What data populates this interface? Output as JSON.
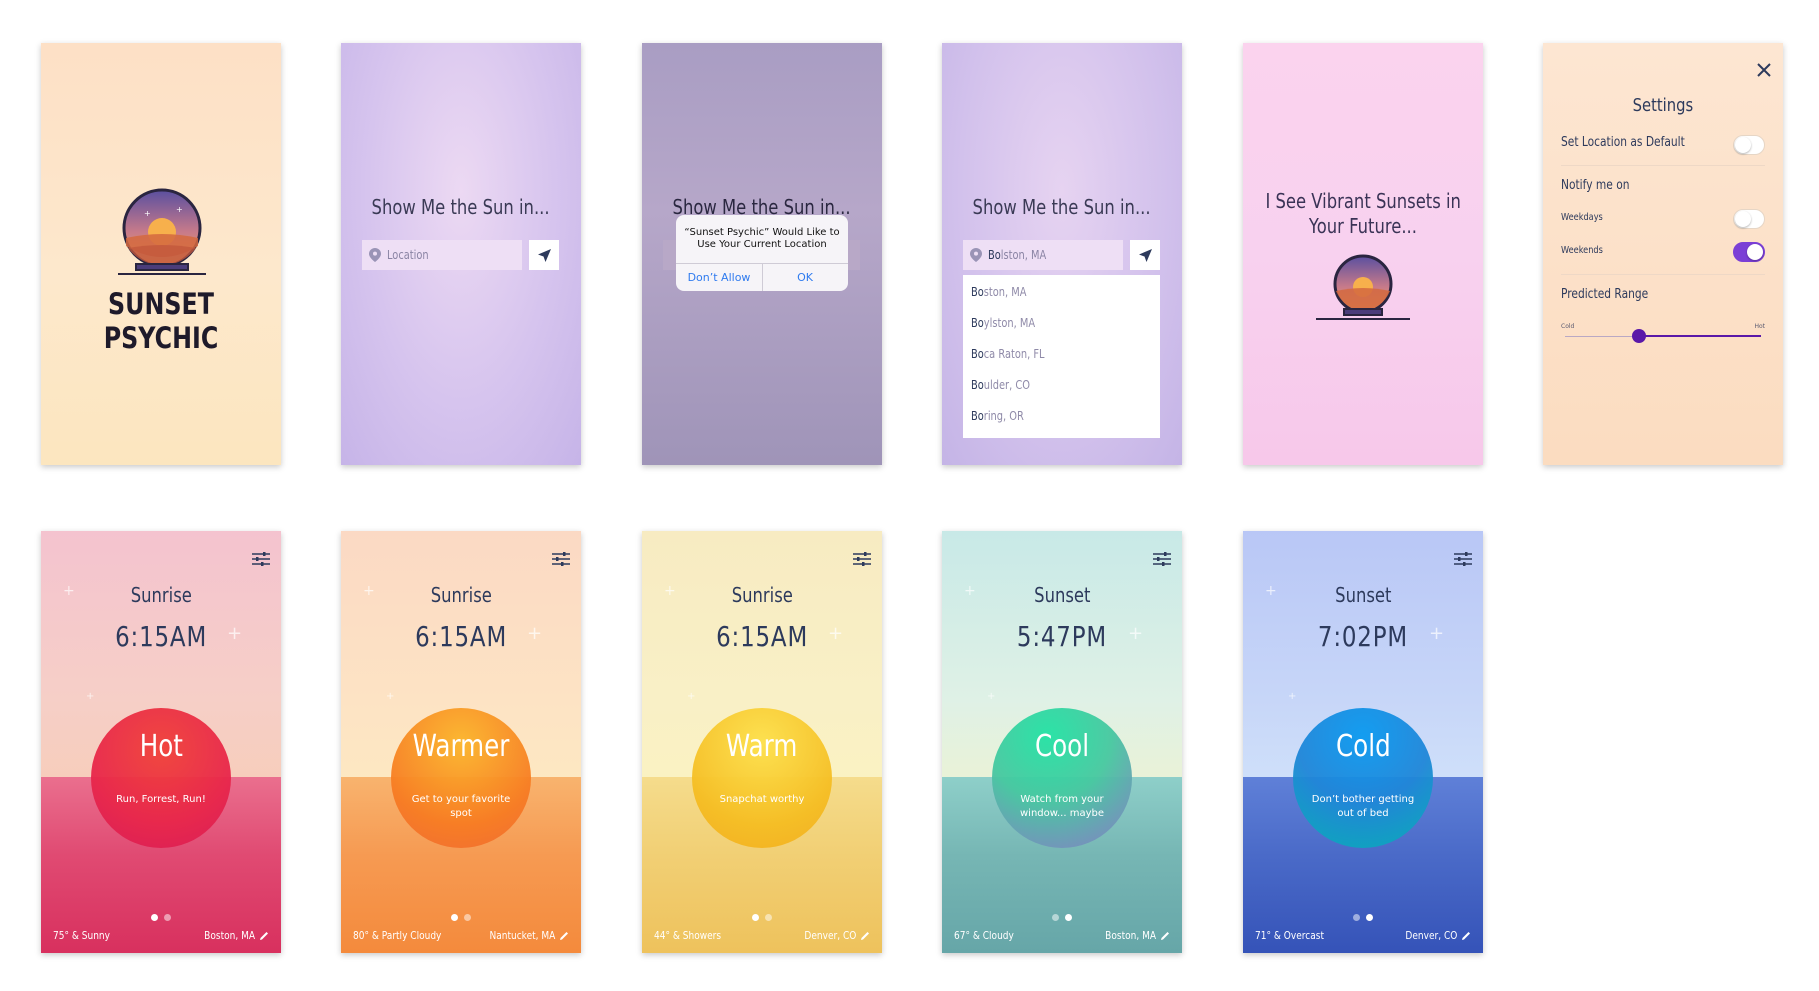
{
  "splash": {
    "logo_text": "SUNSET PSYCHIC"
  },
  "location_screen": {
    "title": "Show Me the Sun in...",
    "placeholder": "Location",
    "pin_icon": "map-pin-icon",
    "locate_icon": "location-arrow-icon"
  },
  "alert_screen": {
    "title": "Show Me the Sun in...",
    "alert_message": "“Sunset Psychic” Would Like to Use Your Current Location",
    "dont_allow": "Don’t Allow",
    "ok": "OK"
  },
  "autocomplete_screen": {
    "title": "Show Me the Sun in...",
    "typed_bold": "Bo",
    "typed_rest": "lston, MA",
    "suggestions": [
      {
        "bold": "Bo",
        "rest": "ston, MA"
      },
      {
        "bold": "Bo",
        "rest": "ylston, MA"
      },
      {
        "bold": "Bo",
        "rest": "ca Raton, FL"
      },
      {
        "bold": "Bo",
        "rest": "ulder, CO"
      },
      {
        "bold": "Bo",
        "rest": "ring, OR"
      }
    ]
  },
  "future_screen": {
    "line1": "I See Vibrant Sunsets in",
    "line2": "Your Future..."
  },
  "settings": {
    "title": "Settings",
    "set_default": "Set Location as Default",
    "set_default_on": false,
    "notify_header": "Notify me on",
    "weekdays": "Weekdays",
    "weekdays_on": false,
    "weekends": "Weekends",
    "weekends_on": true,
    "range_header": "Predicted Range",
    "range_min_label": "Cold",
    "range_max_label": "Hot",
    "range_value": 0.38,
    "close_icon": "close-icon",
    "accent": "#5a18a8"
  },
  "forecasts": [
    {
      "event": "Sunrise",
      "time": "6:15AM",
      "label": "Hot",
      "sub": "Run, Forrest, Run!",
      "weather": "75° & Sunny",
      "city": "Boston, MA",
      "page": 0
    },
    {
      "event": "Sunrise",
      "time": "6:15AM",
      "label": "Warmer",
      "sub": "Get to your favorite spot",
      "weather": "80° & Partly Cloudy",
      "city": "Nantucket, MA",
      "page": 0
    },
    {
      "event": "Sunrise",
      "time": "6:15AM",
      "label": "Warm",
      "sub": "Snapchat worthy",
      "weather": "44° & Showers",
      "city": "Denver, CO",
      "page": 0
    },
    {
      "event": "Sunset",
      "time": "5:47PM",
      "label": "Cool",
      "sub": "Watch from your window... maybe",
      "weather": "67° & Cloudy",
      "city": "Boston, MA",
      "page": 1
    },
    {
      "event": "Sunset",
      "time": "7:02PM",
      "label": "Cold",
      "sub": "Don’t bother getting out of bed",
      "weather": "71° & Overcast",
      "city": "Denver, CO",
      "page": 1
    }
  ],
  "colors": {
    "navy": "#2d3a5c",
    "hot": "#e8264a",
    "warmer": "#f77b22",
    "warm": "#f5bd22",
    "cool": "#46c8a0",
    "cold": "#1f86d8"
  }
}
